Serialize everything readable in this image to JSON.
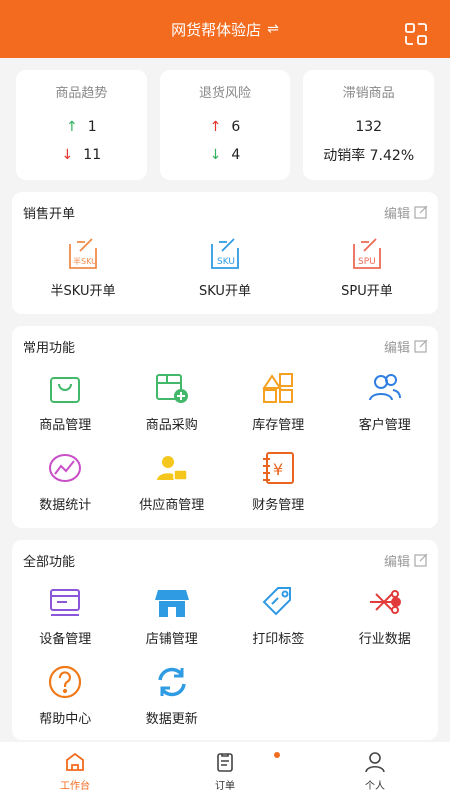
{
  "header": {
    "store_name": "网货帮体验店",
    "switch_icon": "⇌"
  },
  "stats": {
    "trend": {
      "title": "商品趋势",
      "up": "1",
      "down": "11"
    },
    "return": {
      "title": "退货风险",
      "up": "6",
      "down": "4"
    },
    "slow": {
      "title": "滞销商品",
      "count": "132",
      "rate": "动销率 7.42%"
    }
  },
  "sales": {
    "title": "销售开单",
    "edit": "编辑",
    "items": [
      {
        "label": "半SKU开单",
        "icon": "half-sku-icon"
      },
      {
        "label": "SKU开单",
        "icon": "sku-icon"
      },
      {
        "label": "SPU开单",
        "icon": "spu-icon"
      }
    ]
  },
  "common": {
    "title": "常用功能",
    "edit": "编辑",
    "items": [
      {
        "label": "商品管理"
      },
      {
        "label": "商品采购"
      },
      {
        "label": "库存管理"
      },
      {
        "label": "客户管理"
      },
      {
        "label": "数据统计"
      },
      {
        "label": "供应商管理"
      },
      {
        "label": "财务管理"
      }
    ]
  },
  "all": {
    "title": "全部功能",
    "edit": "编辑",
    "items": [
      {
        "label": "设备管理"
      },
      {
        "label": "店铺管理"
      },
      {
        "label": "打印标签"
      },
      {
        "label": "行业数据"
      },
      {
        "label": "帮助中心"
      },
      {
        "label": "数据更新"
      }
    ]
  },
  "tabbar": {
    "workbench": "工作台",
    "orders": "订单",
    "profile": "个人"
  },
  "colors": {
    "accent": "#f26b1f",
    "up_green": "#2fb15d",
    "down_red": "#e5332a"
  }
}
